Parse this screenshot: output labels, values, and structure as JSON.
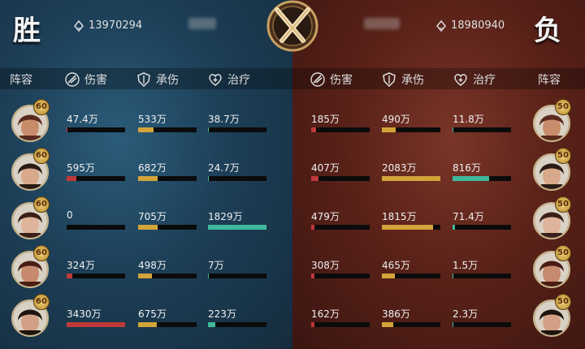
{
  "left_team": {
    "result": "胜",
    "power": "13970294",
    "rows": [
      {
        "level": "60",
        "damage": "47.4万",
        "damage_pct": 0.014,
        "taken": "533万",
        "taken_pct": 0.26,
        "heal": "38.7万",
        "heal_pct": 0.02
      },
      {
        "level": "60",
        "damage": "595万",
        "damage_pct": 0.17,
        "taken": "682万",
        "taken_pct": 0.33,
        "heal": "24.7万",
        "heal_pct": 0.014
      },
      {
        "level": "60",
        "damage": "0",
        "damage_pct": 0,
        "taken": "705万",
        "taken_pct": 0.34,
        "heal": "1829万",
        "heal_pct": 1.0
      },
      {
        "level": "60",
        "damage": "324万",
        "damage_pct": 0.095,
        "taken": "498万",
        "taken_pct": 0.24,
        "heal": "7万",
        "heal_pct": 0.004
      },
      {
        "level": "60",
        "damage": "3430万",
        "damage_pct": 1.0,
        "taken": "675万",
        "taken_pct": 0.32,
        "heal": "223万",
        "heal_pct": 0.12
      }
    ]
  },
  "right_team": {
    "result": "负",
    "power": "18980940",
    "rows": [
      {
        "level": "50",
        "damage": "185万",
        "damage_pct": 0.09,
        "taken": "490万",
        "taken_pct": 0.24,
        "heal": "11.8万",
        "heal_pct": 0.014
      },
      {
        "level": "50",
        "damage": "407万",
        "damage_pct": 0.12,
        "taken": "2083万",
        "taken_pct": 1.0,
        "heal": "816万",
        "heal_pct": 0.62
      },
      {
        "level": "50",
        "damage": "479万",
        "damage_pct": 0.06,
        "taken": "1815万",
        "taken_pct": 0.87,
        "heal": "71.4万",
        "heal_pct": 0.04
      },
      {
        "level": "50",
        "damage": "308万",
        "damage_pct": 0.06,
        "taken": "465万",
        "taken_pct": 0.22,
        "heal": "1.5万",
        "heal_pct": 0.004
      },
      {
        "level": "50",
        "damage": "162万",
        "damage_pct": 0.06,
        "taken": "386万",
        "taken_pct": 0.19,
        "heal": "2.3万",
        "heal_pct": 0.02
      }
    ]
  },
  "columns": {
    "lineup": "阵容",
    "damage": "伤害",
    "taken": "承伤",
    "heal": "治疗"
  },
  "colors": {
    "damage": "#c0393a",
    "taken": "#d2a43a",
    "heal": "#3eb99c"
  },
  "icons": [
    "power-icon",
    "crossed-swords-emblem",
    "damage-icon",
    "shield-icon",
    "heal-icon",
    "avatar"
  ]
}
